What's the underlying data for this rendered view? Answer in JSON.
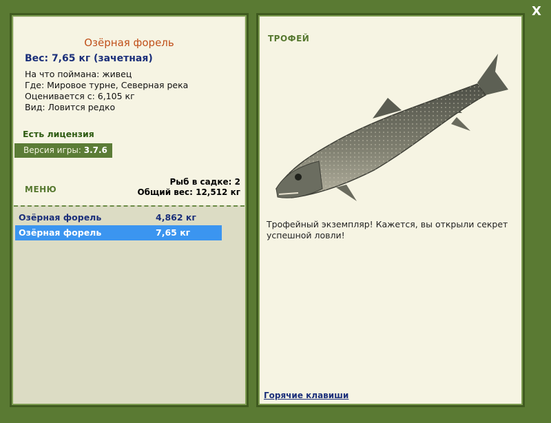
{
  "window": {
    "close_label": "X"
  },
  "fish": {
    "title": "Озёрная форель",
    "weight_line": "Вес: 7,65 кг (зачетная)",
    "details": [
      "На что поймана: живец",
      "Где: Мировое турне, Северная река",
      "Оценивается с: 6,105 кг",
      "Вид: Ловится редко"
    ]
  },
  "license": "Есть лицензия",
  "version": {
    "label": "Версия игры:",
    "value": "3.7.6"
  },
  "menu_label": "МЕНЮ",
  "keepnet": {
    "count_line": "Рыб в садке: 2",
    "total_line": "Общий вес: 12,512 кг"
  },
  "catches": [
    {
      "name": "Озёрная форель",
      "weight": "4,862 кг",
      "selected": false
    },
    {
      "name": "Озёрная форель",
      "weight": "7,65 кг",
      "selected": true
    }
  ],
  "trophy": {
    "label": "ТРОФЕЙ",
    "text": "Трофейный экземпляр! Кажется, вы открыли секрет успешной ловли!"
  },
  "hotkeys_label": "Горячие клавиши",
  "colors": {
    "frame_green": "#5a7a33",
    "title_orange": "#c0501a",
    "weight_blue": "#1b2f7a",
    "selected_row": "#3b95f0"
  },
  "icons": {
    "fish_image": "lake-trout-illustration"
  }
}
